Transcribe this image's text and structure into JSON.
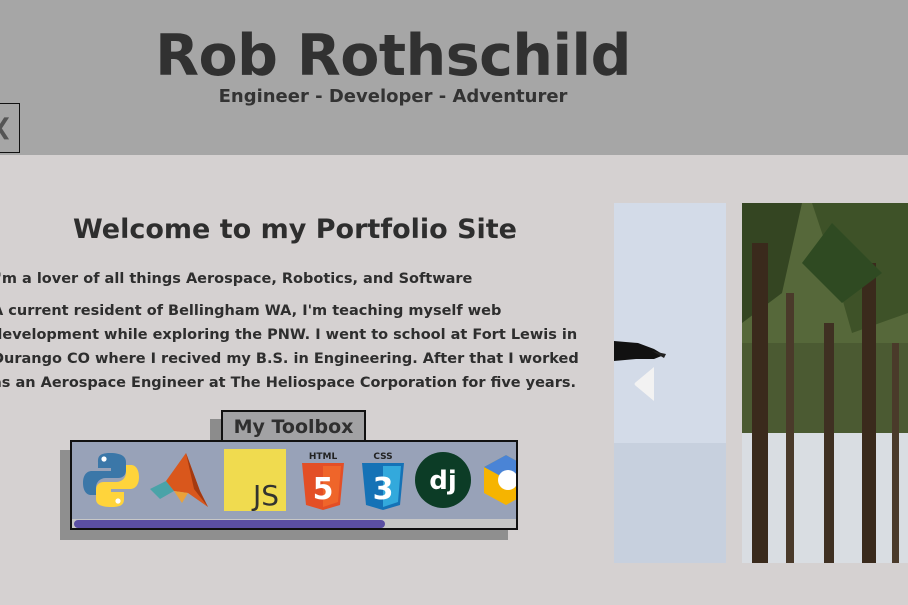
{
  "header": {
    "title": "Rob Rothschild",
    "tagline": "Engineer - Developer - Adventurer",
    "menu_icon": "chevron-left-icon"
  },
  "main": {
    "heading": "Welcome to my Portfolio Site",
    "intro_1": "I'm a lover of all things Aerospace, Robotics, and Software",
    "intro_2": "A current resident of Bellingham WA, I'm teaching myself web development while exploring the PNW. I went to school at Fort Lewis in Durango CO where I recived my B.S. in Engineering. After that I worked as an Aerospace Engineer at The Heliospace Corporation for five years."
  },
  "toolbox": {
    "label": "My Toolbox",
    "icons": [
      {
        "name": "python-icon"
      },
      {
        "name": "matlab-icon"
      },
      {
        "name": "javascript-icon",
        "text": "JS"
      },
      {
        "name": "html5-icon",
        "text": "HTML",
        "glyph": "5"
      },
      {
        "name": "css3-icon",
        "text": "CSS",
        "glyph": "3"
      },
      {
        "name": "django-icon",
        "text": "dj"
      },
      {
        "name": "gcp-icon"
      }
    ],
    "scroll_fraction": 0.7,
    "colors": {
      "panel": "#98a2b8",
      "scroll_thumb": "#5b4fa3"
    }
  },
  "gallery": {
    "prev_icon": "chevron-left-icon",
    "photos": [
      {
        "name": "snow-hand-photo"
      },
      {
        "name": "forest-photo"
      }
    ]
  }
}
